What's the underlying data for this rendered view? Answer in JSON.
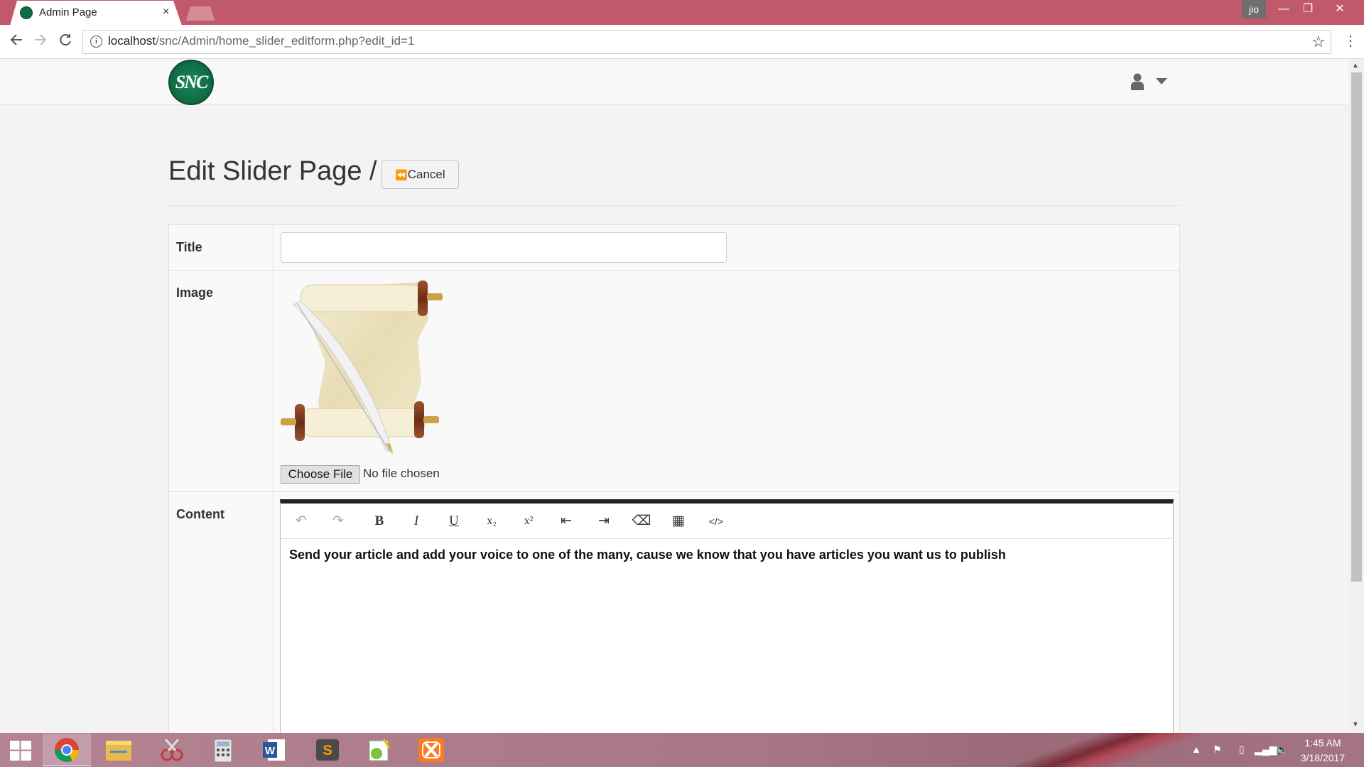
{
  "browser": {
    "tab_title": "Admin Page",
    "tab_close": "×",
    "profile_label": "jio",
    "url_host": "localhost",
    "url_path": "/snc/Admin/home_slider_editform.php?edit_id=1",
    "window_controls": {
      "minimize": "—",
      "maximize": "❐",
      "close": "✕"
    },
    "icons": {
      "back": "arrow-left-icon",
      "forward": "arrow-right-icon",
      "reload": "reload-icon",
      "info": "info-icon",
      "star": "star-icon",
      "menu": "kebab-menu-icon"
    }
  },
  "header": {
    "logo_text": "SNC",
    "user_menu_icon": "user-icon"
  },
  "page": {
    "title": "Edit Slider Page /",
    "cancel_icon": "⏪",
    "cancel_label": "Cancel"
  },
  "form": {
    "title_label": "Title",
    "title_value": "",
    "image_label": "Image",
    "choose_file_label": "Choose File",
    "no_file_text": "No file chosen",
    "content_label": "Content",
    "content_text": "Send your article and add your voice to one of the many,  cause we know that you have articles you want us to publish"
  },
  "editor_toolbar": {
    "undo": "↶",
    "redo": "↷",
    "bold": "B",
    "italic": "I",
    "underline": "U",
    "subscript": "x₂",
    "superscript": "x²",
    "outdent": "⇤",
    "indent": "⇥",
    "clear_format": "⌫",
    "table": "▦",
    "code": "</>"
  },
  "taskbar": {
    "time": "1:45 AM",
    "date": "3/18/2017",
    "apps": [
      "chrome-icon",
      "file-explorer-icon",
      "snipping-tool-icon",
      "calculator-icon",
      "word-icon",
      "sublime-text-icon",
      "notepad-plus-icon",
      "xampp-icon"
    ],
    "tray_expand": "▲"
  },
  "colors": {
    "titlebar": "#c0596a",
    "taskbar": "#a87786",
    "logo_green": "#0f6e45"
  }
}
